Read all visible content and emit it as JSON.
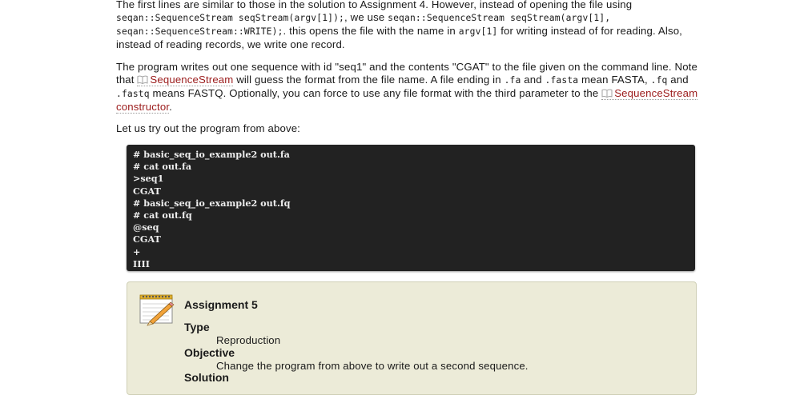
{
  "p1": {
    "t1": "The first lines are similar to those in the solution to Assignment 4. However, instead of opening the file using",
    "c1": "seqan::SequenceStream seqStream(argv[1]);",
    "t2": ", we use ",
    "c2": "seqan::SequenceStream seqStream(argv[1], seqan::SequenceStream::WRITE);",
    "t3": ". this opens the file with the name in ",
    "c3": "argv[1]",
    "t4": " for writing instead of for reading. Also, instead of reading records, we write one record."
  },
  "p2": {
    "t1": "The program writes out one sequence with id \"seq1\" and the contents \"CGAT\" to the file given on the command line. Note that ",
    "link1": "SequenceStream",
    "t2": " will guess the format from the file name. A file ending in ",
    "c1": ".fa",
    "t3": " and ",
    "c2": ".fasta",
    "t4": " mean FASTA, ",
    "c3": ".fq",
    "t5": " and ",
    "c4": ".fastq",
    "t6": " means FASTQ. Optionally, you can force to use any file format with the third parameter to the ",
    "link2": "SequenceStream constructor",
    "t7": "."
  },
  "p3": {
    "text": "Let us try out the program from above:"
  },
  "terminal": {
    "text": "# basic_seq_io_example2 out.fa\n# cat out.fa\n>seq1\nCGAT\n# basic_seq_io_example2 out.fq\n# cat out.fq\n@seq\nCGAT\n+\nIIII"
  },
  "assignment": {
    "title": "Assignment 5",
    "type_label": "Type",
    "type_value": "Reproduction",
    "objective_label": "Objective",
    "objective_value": "Change the program from above to write out a second sequence.",
    "solution_label": "Solution"
  },
  "colors": {
    "link": "#9b1b1b",
    "terminal_bg": "#222222",
    "assignment_bg": "#ecebd8"
  },
  "icons": [
    "book-icon",
    "notepad-icon"
  ]
}
